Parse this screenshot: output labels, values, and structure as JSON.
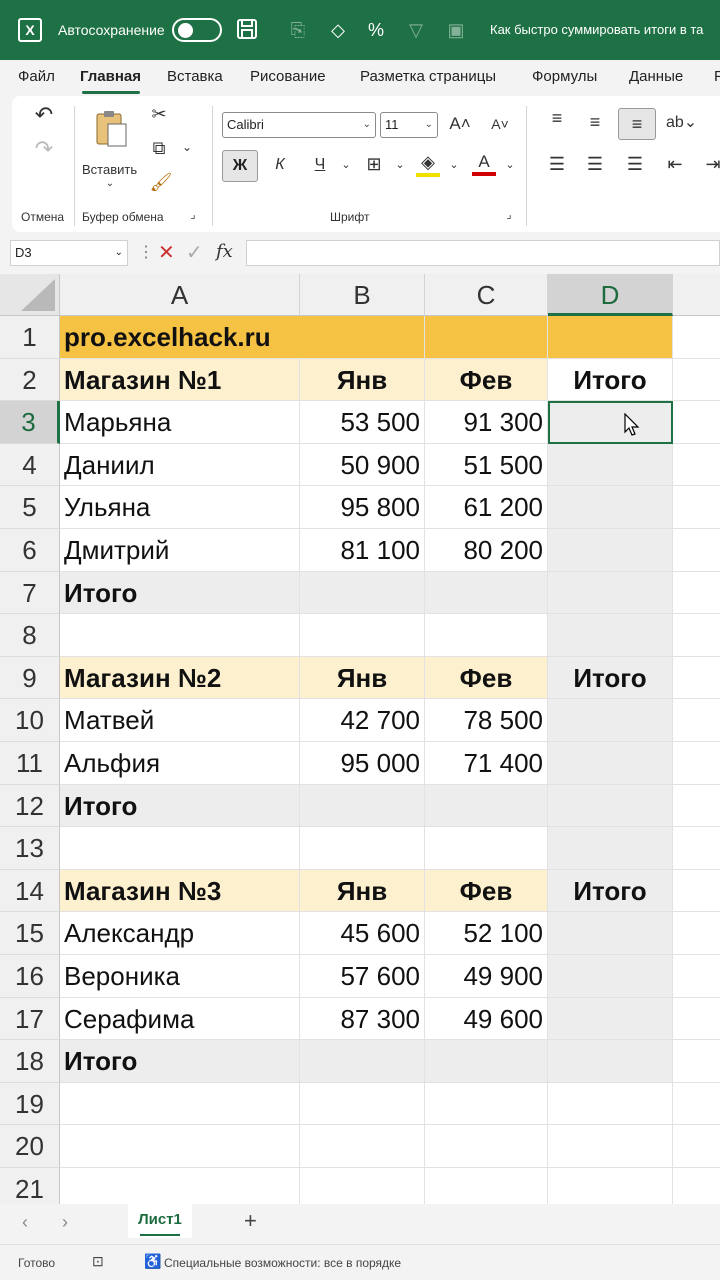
{
  "titlebar": {
    "app_icon": "X",
    "autosave_label": "Автосохранение",
    "doc_title": "Как быстро суммировать итоги в та"
  },
  "menu": {
    "tabs": [
      "Файл",
      "Главная",
      "Вставка",
      "Рисование",
      "Разметка страницы",
      "Формулы",
      "Данные",
      "Р"
    ],
    "active": "Главная"
  },
  "ribbon": {
    "undo_group": "Отмена",
    "paste_label": "Вставить",
    "clipboard_group": "Буфер обмена",
    "font_name": "Calibri",
    "font_size": "11",
    "bold": "Ж",
    "italic": "К",
    "underline": "Ч",
    "font_color_letter": "A",
    "font_group": "Шрифт"
  },
  "formula_bar": {
    "name_box": "D3",
    "fx": "fx"
  },
  "grid": {
    "columns": [
      "A",
      "B",
      "C",
      "D"
    ],
    "rows": [
      "1",
      "2",
      "3",
      "4",
      "5",
      "6",
      "7",
      "8",
      "9",
      "10",
      "11",
      "12",
      "13",
      "14",
      "15",
      "16",
      "17",
      "18",
      "19",
      "20",
      "21"
    ],
    "cells": {
      "A1": "pro.excelhack.ru",
      "A2": "Магазин №1",
      "B2": "Янв",
      "C2": "Фев",
      "D2": "Итого",
      "A3": "Марьяна",
      "B3": "53 500",
      "C3": "91 300",
      "A4": "Даниил",
      "B4": "50 900",
      "C4": "51 500",
      "A5": "Ульяна",
      "B5": "95 800",
      "C5": "61 200",
      "A6": "Дмитрий",
      "B6": "81 100",
      "C6": "80 200",
      "A7": "Итого",
      "A9": "Магазин №2",
      "B9": "Янв",
      "C9": "Фев",
      "D9": "Итого",
      "A10": "Матвей",
      "B10": "42 700",
      "C10": "78 500",
      "A11": "Альфия",
      "B11": "95 000",
      "C11": "71 400",
      "A12": "Итого",
      "A14": "Магазин №3",
      "B14": "Янв",
      "C14": "Фев",
      "D14": "Итого",
      "A15": "Александр",
      "B15": "45 600",
      "C15": "52 100",
      "A16": "Вероника",
      "B16": "57 600",
      "C16": "49 900",
      "A17": "Серафима",
      "B17": "87 300",
      "C17": "49 600",
      "A18": "Итого"
    },
    "selected_cell": "D3"
  },
  "sheets": {
    "tabs": [
      "Лист1"
    ],
    "add": "+"
  },
  "status": {
    "ready": "Готово",
    "accessibility": "Специальные возможности: все в порядке"
  },
  "colors": {
    "excel_green": "#1e7145",
    "title_row": "#f6c244",
    "header_row": "#fdf0cf",
    "selection_gray": "#ededed"
  },
  "icons": [
    "excel-icon",
    "save-icon",
    "undo-icon",
    "redo-icon",
    "paste-icon",
    "cut-icon",
    "copy-icon",
    "format-painter-icon",
    "fx-icon",
    "cancel-icon",
    "enter-icon",
    "cursor-icon"
  ]
}
